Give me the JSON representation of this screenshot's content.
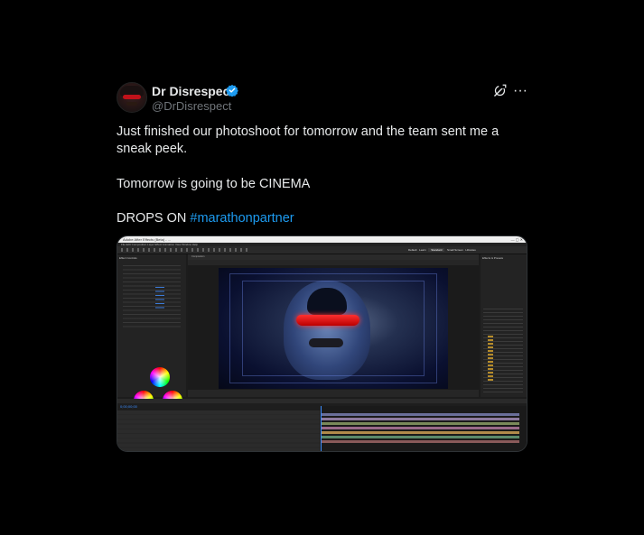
{
  "author": {
    "name": "Dr Disrespect",
    "handle": "@DrDisrespect",
    "verified_color": "#1d9bf0"
  },
  "actions": {
    "grok_icon": "grok-icon",
    "more_icon": "more-icon",
    "more_glyph": "···"
  },
  "post": {
    "line1": "Just finished our photoshoot for tomorrow and the team sent me a sneak peek.",
    "line2": "Tomorrow is going to be CINEMA",
    "line3_prefix": "DROPS ON ",
    "hashtag": "#marathonpartner",
    "hashtag_color": "#1d9bf0"
  },
  "media": {
    "app_titlebar": "Adobe After Effects (Beta) - ...",
    "menubar": "File  Edit  Composition  Layer  Effect  Animation  View  Window  Help",
    "workspace_tabs": [
      "Default",
      "Learn",
      "Standard",
      "Small Screen",
      "Libraries"
    ],
    "active_workspace": "Standard",
    "effect_controls_header": "Effect Controls",
    "composition_tab": "Composition",
    "effects_header": "Effects & Presets",
    "timeline_time": "0;00;00;00"
  }
}
